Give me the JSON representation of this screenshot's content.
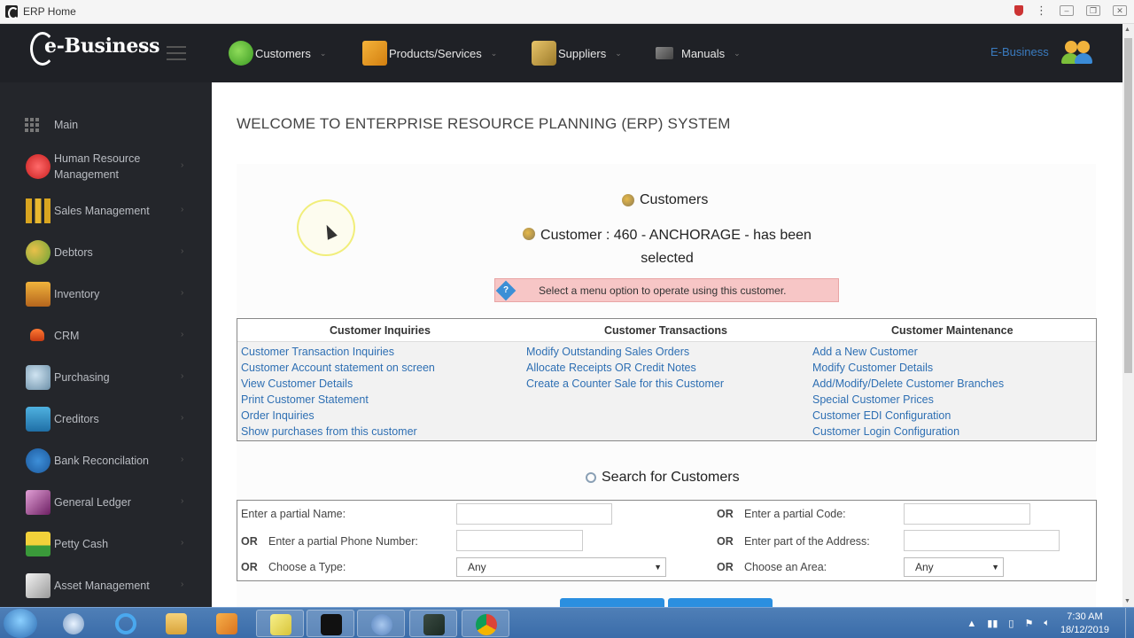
{
  "window": {
    "title": "ERP Home"
  },
  "topbar": {
    "logo": "e-Business",
    "nav": [
      {
        "label": "Customers",
        "icon": "customers-icon"
      },
      {
        "label": "Products/Services",
        "icon": "box-icon"
      },
      {
        "label": "Suppliers",
        "icon": "suppliers-icon"
      },
      {
        "label": "Manuals",
        "icon": "manuals-icon"
      }
    ],
    "user_link": "E-Business",
    "user_icon": "users-icon"
  },
  "sidebar": {
    "items": [
      {
        "label": "Main",
        "icon": "grid-icon"
      },
      {
        "label": "Human Resource Management",
        "icon": "hr-icon"
      },
      {
        "label": "Sales Management",
        "icon": "sales-chart-icon"
      },
      {
        "label": "Debtors",
        "icon": "debtors-icon"
      },
      {
        "label": "Inventory",
        "icon": "inventory-icon"
      },
      {
        "label": "CRM",
        "icon": "crm-icon"
      },
      {
        "label": "Purchasing",
        "icon": "purchasing-icon"
      },
      {
        "label": "Creditors",
        "icon": "creditors-icon"
      },
      {
        "label": "Bank Reconcilation",
        "icon": "scales-icon"
      },
      {
        "label": "General Ledger",
        "icon": "ledger-icon"
      },
      {
        "label": "Petty Cash",
        "icon": "petty-cash-icon"
      },
      {
        "label": "Asset Management",
        "icon": "asset-icon"
      }
    ]
  },
  "main": {
    "welcome": "WELCOME TO ENTERPRISE RESOURCE PLANNING (ERP) SYSTEM",
    "customers_heading": "Customers",
    "customer_selected": "Customer : 460 - ANCHORAGE - has been selected",
    "notice": "Select a menu option to operate using this customer.",
    "menu": {
      "inquiries": {
        "title": "Customer Inquiries",
        "links": [
          "Customer Transaction Inquiries",
          "Customer Account statement on screen",
          "View Customer Details",
          "Print Customer Statement",
          "Order Inquiries",
          "Show purchases from this customer"
        ]
      },
      "transactions": {
        "title": "Customer Transactions",
        "links": [
          "Modify Outstanding Sales Orders",
          "Allocate Receipts OR Credit Notes",
          "Create a Counter Sale for this Customer"
        ]
      },
      "maintenance": {
        "title": "Customer Maintenance",
        "links": [
          "Add a New Customer",
          "Modify Customer Details",
          "Add/Modify/Delete Customer Branches",
          "Special Customer Prices",
          "Customer EDI Configuration",
          "Customer Login Configuration"
        ]
      }
    },
    "search": {
      "heading": "Search for Customers",
      "or": "OR",
      "partial_name": "Enter a partial Name:",
      "partial_code": "Enter a partial Code:",
      "partial_phone": "Enter a partial Phone Number:",
      "part_address": "Enter part of the Address:",
      "choose_type": "Choose a Type:",
      "choose_area": "Choose an Area:",
      "type_value": "Any",
      "area_value": "Any"
    }
  },
  "taskbar": {
    "time": "7:30 AM",
    "date": "18/12/2019"
  }
}
